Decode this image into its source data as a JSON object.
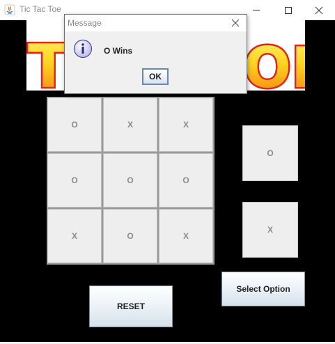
{
  "window": {
    "title": "Tic Tac Toe"
  },
  "banner": {
    "left_text": "TI",
    "right_text": "OE"
  },
  "board": {
    "cells": [
      {
        "value": "O"
      },
      {
        "value": "X"
      },
      {
        "value": "X"
      },
      {
        "value": "O"
      },
      {
        "value": "O"
      },
      {
        "value": "O"
      },
      {
        "value": "X"
      },
      {
        "value": "O"
      },
      {
        "value": "X"
      }
    ]
  },
  "side_panel": {
    "option_top": "O",
    "option_bottom": "X",
    "select_label": "Select Option"
  },
  "controls": {
    "reset_label": "RESET"
  },
  "dialog": {
    "title": "Message",
    "message": "O Wins",
    "ok_label": "OK"
  },
  "colors": {
    "background": "#000000",
    "cell": "#eeeeee",
    "mark": "#8a8a8a",
    "banner_yellow": "#ffd21f",
    "banner_orange": "#f57a12",
    "banner_red": "#e0231b"
  }
}
